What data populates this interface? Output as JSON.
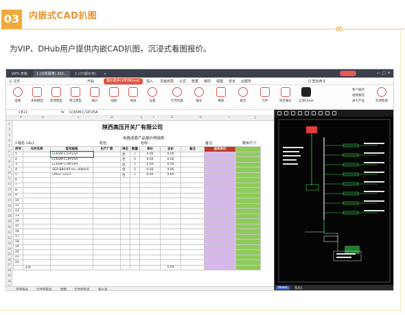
{
  "section": {
    "number": "03",
    "title": "内嵌式CAD扒图",
    "description": "为VIP、DHub用户提供内嵌CAD扒图，沉浸式看图报价。"
  },
  "window": {
    "titlebar_tabs": [
      "WPS 表格",
      "1 (分析报表) 202...",
      "2 (CH报价单)"
    ],
    "menu_items": [
      "三 文件",
      "开始",
      "插入",
      "页面布局",
      "公式",
      "数据",
      "审阅",
      "视图",
      "安全",
      "云服务"
    ],
    "menu_active": "报价助手(VIP/Wince)",
    "search_label": "Q 查找命令",
    "ribbon_buttons": [
      "查看",
      "本机模型",
      "新建模型",
      "建立模型",
      "报价",
      "插图",
      "相关",
      "设置",
      "补充",
      "兼容产品",
      "元件批量",
      "编号",
      "模板",
      "集合",
      "元件",
      "组合报价",
      "全景DHub"
    ],
    "ribbon_side": [
      "客户服务",
      "视频教程",
      "关于产品",
      "在线客服"
    ],
    "formula_cell": "CE11",
    "formula_fx": "fx",
    "formula_value": "LC6SM-C/1P/25A"
  },
  "sheet": {
    "title": "陕西高压开关厂有限公司",
    "subtitle": "电器成套产品报价明细表",
    "meta_project": "工程名:",
    "meta_project_value": "1AL1",
    "meta_cabinet": "柜名:",
    "meta_code": "名称:",
    "meta_note": "备注:",
    "meta_size": "箱体尺寸:",
    "headers": [
      "序号",
      "元件名称",
      "型号规格",
      "生产厂家",
      "单位",
      "数量",
      "单价",
      "总价",
      "备注",
      "成本单价",
      ""
    ],
    "rows": [
      [
        "1",
        "",
        "LC6SM-C/1P/25A",
        "",
        "台",
        "7",
        "0.00",
        "0.00",
        "",
        "",
        ""
      ],
      [
        "2",
        "",
        "LC6SM-C/3P/25A",
        "",
        "台",
        "1",
        "0.00",
        "0.00",
        "",
        "",
        ""
      ],
      [
        "3",
        "",
        "LC6SM-C/4P/50A",
        "",
        "台",
        "1",
        "0.00",
        "0.00",
        "",
        "",
        ""
      ],
      [
        "4",
        "",
        "SGP-B80/4P Im=40KA(0.",
        "",
        "台",
        "1",
        "0.00",
        "0.00",
        "",
        "",
        ""
      ],
      [
        "5",
        "",
        "CM52-125/3",
        "",
        "台",
        "1",
        "0.00",
        "0.00",
        "",
        "",
        ""
      ]
    ],
    "empty_rows": 17,
    "total_label": "小计",
    "total_value": "0.00",
    "column_letters": [
      "A",
      "B",
      "C",
      "D",
      "E",
      "F",
      "G",
      "H",
      "I",
      "J"
    ],
    "row_numbers": [
      "1",
      "2",
      "3",
      "4",
      "5",
      "6",
      "7",
      "8",
      "9",
      "10",
      "11",
      "12",
      "13",
      "14",
      "15",
      "16",
      "17",
      "18",
      "19",
      "20",
      "21",
      "22",
      "23",
      "24",
      "25",
      "26",
      "27",
      "28",
      "29",
      "30",
      "31"
    ],
    "sheet_tabs": [
      "封面报表",
      "元件配套表",
      "明细",
      "元件配套表",
      "报价表"
    ]
  },
  "cad": {
    "tabs": [
      "Model",
      "布局1"
    ],
    "colors": {
      "bg": "#050505",
      "green": "#3ddc5a",
      "white": "#e8e8e8",
      "red": "#e33b3b",
      "yellow": "#e8d84a"
    }
  }
}
